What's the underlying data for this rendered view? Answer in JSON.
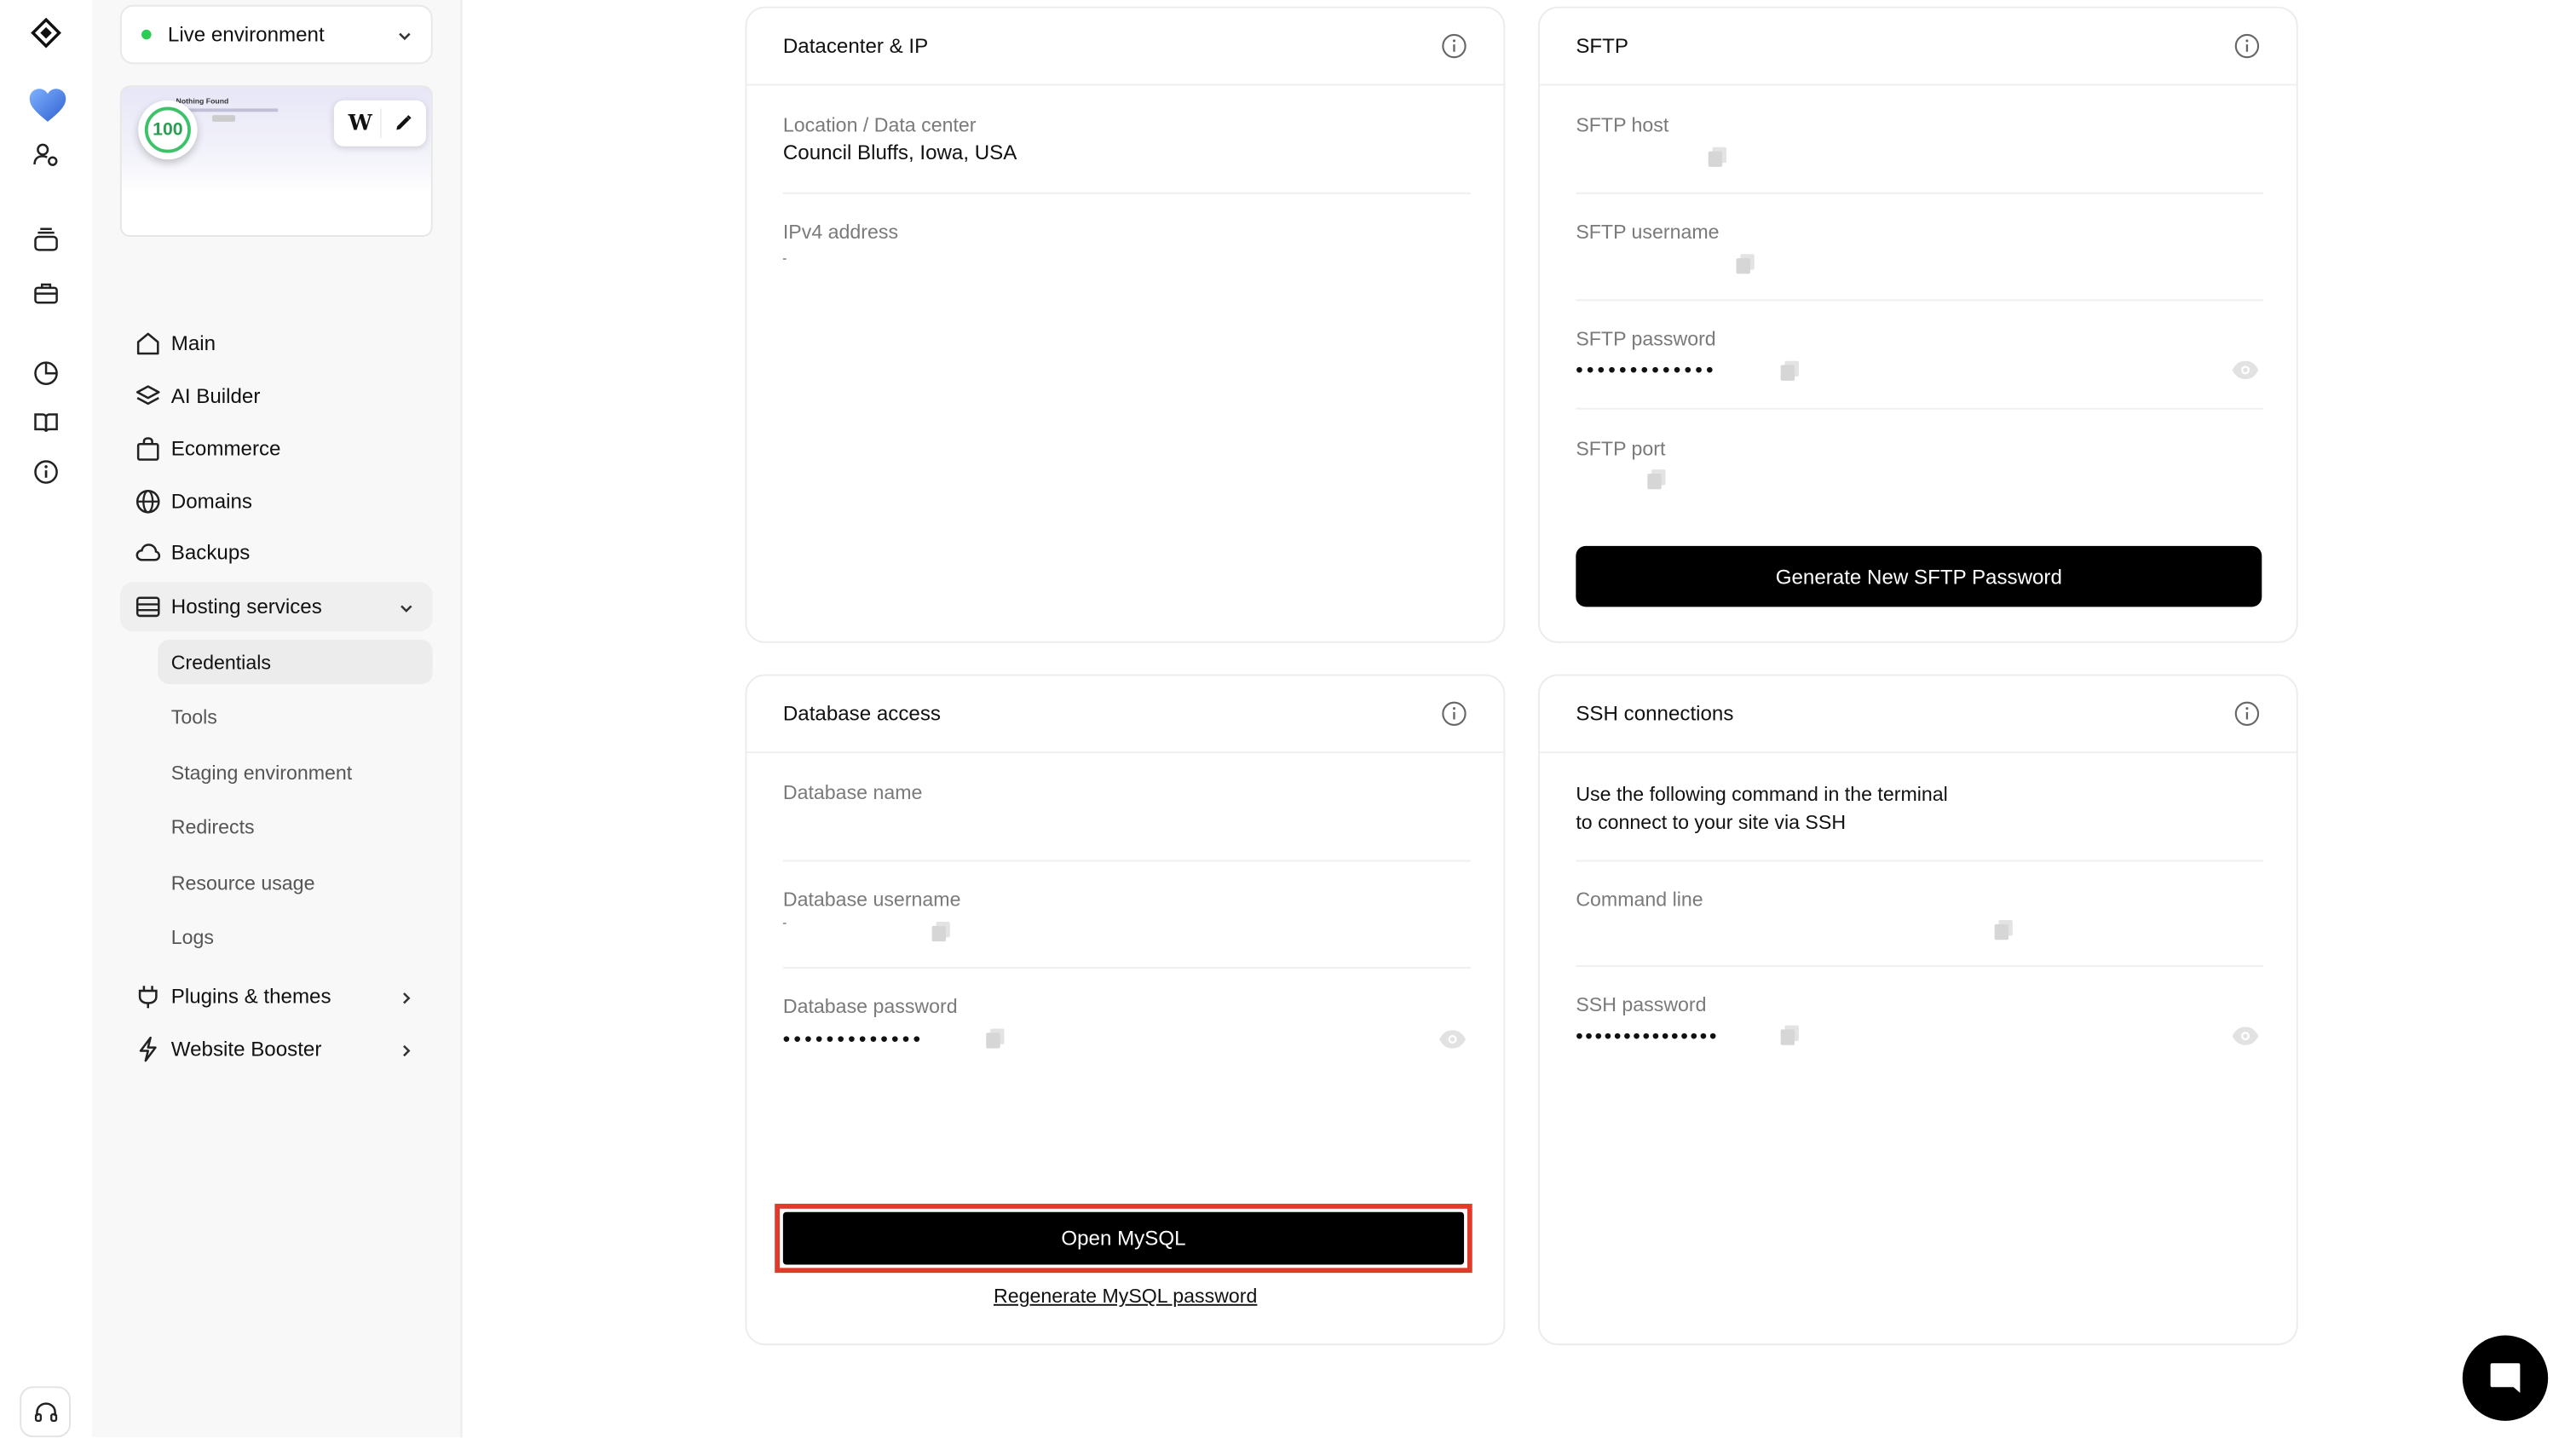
{
  "environment": {
    "label": "Live environment",
    "status_color": "#2ecc55"
  },
  "site_preview": {
    "headline": "Nothing Found",
    "performance_score": "100",
    "builder_badge": "W"
  },
  "icon_rail": {
    "icons": [
      "logo-icon",
      "heart-icon",
      "user-settings-icon",
      "stack-icon",
      "briefcase-icon",
      "analytics-icon",
      "book-icon",
      "info-icon",
      "headset-icon"
    ]
  },
  "nav": {
    "items": [
      {
        "label": "Main",
        "icon": "home-icon"
      },
      {
        "label": "AI Builder",
        "icon": "layers-icon"
      },
      {
        "label": "Ecommerce",
        "icon": "shopping-bag-icon"
      },
      {
        "label": "Domains",
        "icon": "globe-icon"
      },
      {
        "label": "Backups",
        "icon": "cloud-icon"
      },
      {
        "label": "Hosting services",
        "icon": "server-icon"
      },
      {
        "label": "Plugins & themes",
        "icon": "plug-icon"
      },
      {
        "label": "Website Booster",
        "icon": "bolt-icon"
      }
    ],
    "hosting_sub": [
      "Credentials",
      "Tools",
      "Staging environment",
      "Redirects",
      "Resource usage",
      "Logs"
    ]
  },
  "datacenter": {
    "title": "Datacenter & IP",
    "location_label": "Location / Data center",
    "location_value": "Council Bluffs, Iowa, USA",
    "ipv4_label": "IPv4 address"
  },
  "sftp": {
    "title": "SFTP",
    "host_label": "SFTP host",
    "username_label": "SFTP username",
    "password_label": "SFTP password",
    "password_mask": "•••••••••••••",
    "port_label": "SFTP port",
    "generate_button": "Generate New SFTP Password"
  },
  "database": {
    "title": "Database access",
    "name_label": "Database name",
    "username_label": "Database username",
    "password_label": "Database password",
    "password_mask": "•••••••••••••",
    "open_button": "Open MySQL",
    "regenerate_link": "Regenerate MySQL password"
  },
  "ssh": {
    "title": "SSH connections",
    "instructions_line1": "Use the following command in the terminal",
    "instructions_line2": "to connect to your site via SSH",
    "command_label": "Command line",
    "password_label": "SSH password",
    "password_mask": "•••••••••••••••"
  },
  "colors": {
    "accent_black": "#000000",
    "highlight_red": "#e03a2a",
    "status_green": "#2ecc55"
  }
}
